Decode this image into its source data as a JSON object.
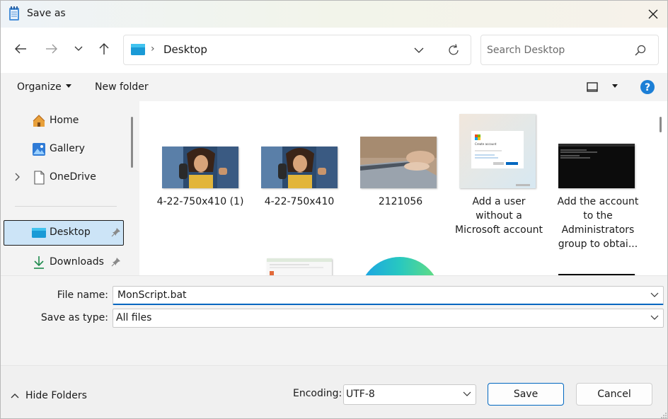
{
  "window": {
    "title": "Save as"
  },
  "navbar": {
    "path_label": "Desktop",
    "search_placeholder": "Search Desktop"
  },
  "cmdbar": {
    "organize_label": "Organize",
    "new_folder_label": "New folder"
  },
  "sidebar": {
    "items": [
      {
        "label": "Home",
        "icon": "home-icon"
      },
      {
        "label": "Gallery",
        "icon": "gallery-icon"
      },
      {
        "label": "OneDrive",
        "icon": "onedrive-icon"
      },
      {
        "label": "Desktop",
        "icon": "desktop-folder-icon"
      },
      {
        "label": "Downloads",
        "icon": "download-icon"
      }
    ]
  },
  "files": [
    {
      "name": "4-22-750x410 (1)"
    },
    {
      "name": "4-22-750x410"
    },
    {
      "name": "2121056"
    },
    {
      "name": "Add a user without a Microsoft account"
    },
    {
      "name": "Add the account to the Administrators group to obtai..."
    }
  ],
  "thumb_texts": {
    "create_account": "Create account"
  },
  "form": {
    "file_name_label": "File name:",
    "file_name_value": "MonScript.bat",
    "save_type_label": "Save as type:",
    "save_type_value": "All files"
  },
  "footer": {
    "hide_folders_label": "Hide Folders",
    "encoding_label": "Encoding:",
    "encoding_value": "UTF-8",
    "save_label": "Save",
    "cancel_label": "Cancel"
  },
  "colors": {
    "accent": "#0067c0",
    "selection": "#cce4f7"
  }
}
